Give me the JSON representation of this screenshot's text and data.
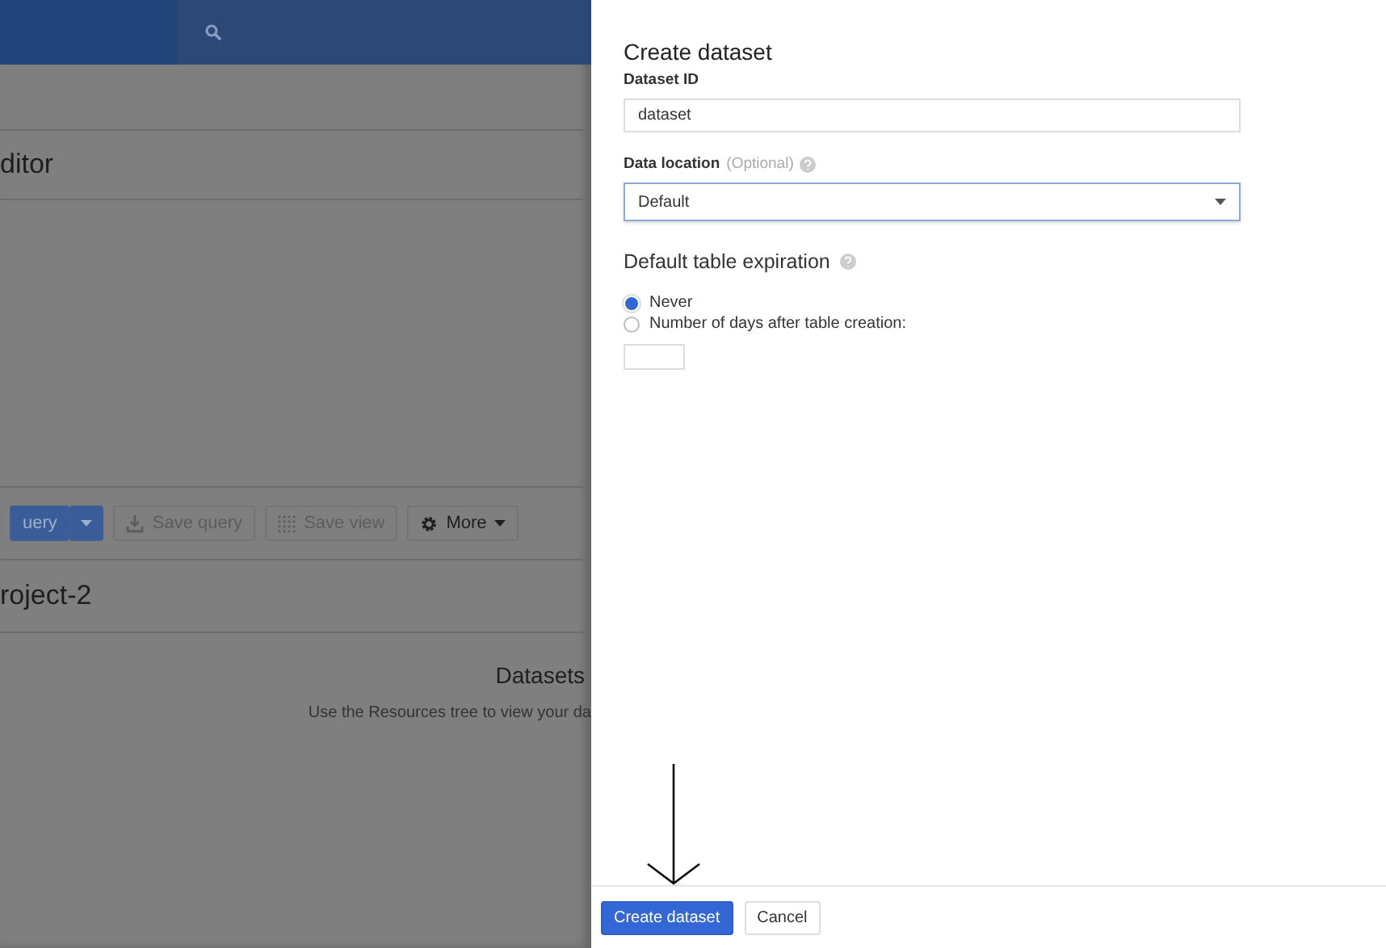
{
  "background": {
    "editor_title": "ditor",
    "toolbar": [
      {
        "kind": "primary",
        "label": "uery"
      },
      {
        "kind": "caret"
      },
      {
        "kind": "plain",
        "label": "Save query"
      },
      {
        "kind": "plain",
        "label": "Save view"
      },
      {
        "kind": "menu",
        "label": "More"
      }
    ],
    "project_title": "roject-2",
    "empty_title": "Datasets",
    "empty_text": "Use the Resources tree to view your da"
  },
  "dialog": {
    "title": "Create dataset",
    "dataset_id": {
      "label": "Dataset ID",
      "value": "dataset"
    },
    "data_location": {
      "label": "Data location",
      "optional": "(Optional)",
      "value": "Default"
    },
    "expiration": {
      "title": "Default table expiration",
      "options": [
        {
          "label": "Never",
          "selected": true
        },
        {
          "label": "Number of days after table creation:",
          "selected": false
        }
      ]
    },
    "buttons": [
      {
        "label": "Create dataset",
        "kind": "primary"
      },
      {
        "label": "Cancel",
        "kind": "secondary"
      }
    ]
  }
}
